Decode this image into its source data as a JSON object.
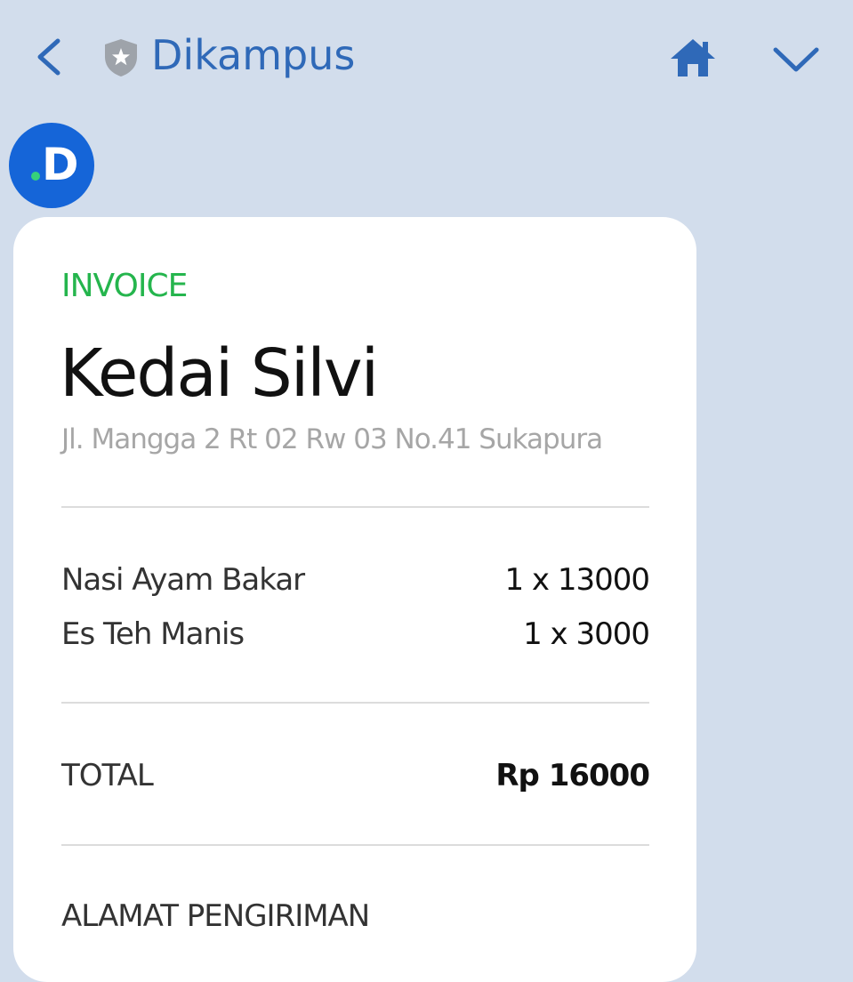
{
  "header": {
    "title": "Dikampus",
    "accent_color": "#2f69b8",
    "icons": [
      "back-icon",
      "shield-star-icon",
      "home-icon",
      "chevron-down-icon"
    ]
  },
  "avatar": {
    "letter": "D",
    "bg_color": "#1565d8",
    "dot_color": "#36d07b"
  },
  "invoice": {
    "label": "INVOICE",
    "label_color": "#25b54d",
    "shop_name": "Kedai Silvi",
    "address": "Jl. Mangga 2 Rt 02 Rw 03 No.41 Sukapura",
    "items": [
      {
        "name": "Nasi Ayam Bakar",
        "qty": "1 x 13000"
      },
      {
        "name": "Es Teh Manis",
        "qty": "1 x 3000"
      }
    ],
    "total_label": "TOTAL",
    "total_amount": "Rp 16000",
    "shipping_title": "ALAMAT PENGIRIMAN"
  }
}
